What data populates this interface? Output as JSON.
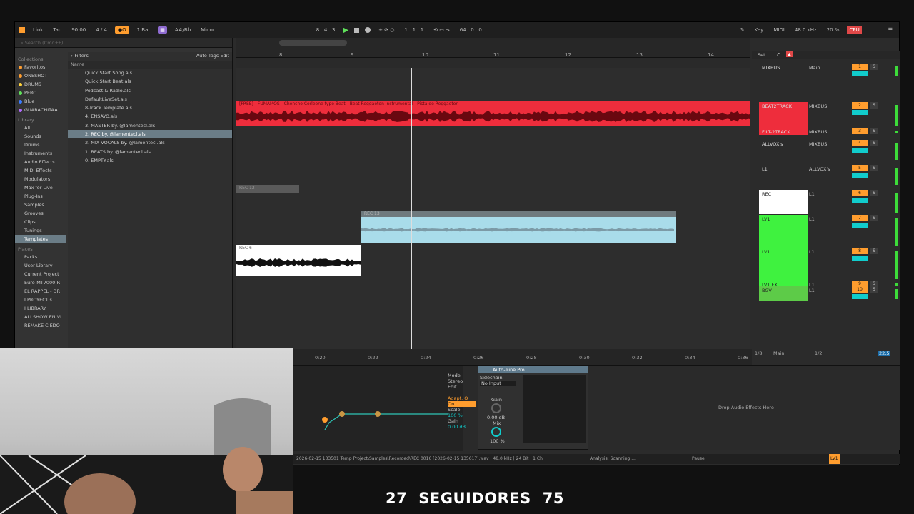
{
  "topbar": {
    "link": "Link",
    "tap": "Tap",
    "tempo": "90.00",
    "sig": "4 / 4",
    "quant": "1 Bar",
    "key": "A#/Bb",
    "scale": "Minor",
    "position": "8 . 4 . 3",
    "loop_start": "1 . 1 . 1",
    "loop_len": "64 . 0 . 0",
    "key_btn": "Key",
    "midi": "MIDI",
    "sample_rate": "48.0 kHz",
    "cpu_pct": "20 %",
    "cpu": "CPU"
  },
  "browser": {
    "search_placeholder": "Search (Cmd+F)",
    "collections_header": "Collections",
    "collections": [
      {
        "label": "Favoritos",
        "color": "#ff9d2e"
      },
      {
        "label": "ONESHOT",
        "color": "#ff9d2e"
      },
      {
        "label": "DRUMS",
        "color": "#ffd23a"
      },
      {
        "label": "PERC",
        "color": "#5fe05a"
      },
      {
        "label": "Blue",
        "color": "#3a7bff"
      },
      {
        "label": "GUARACHITAA",
        "color": "#b36bff"
      }
    ],
    "library_header": "Library",
    "library": [
      "All",
      "Sounds",
      "Drums",
      "Instruments",
      "Audio Effects",
      "MIDI Effects",
      "Modulators",
      "Max for Live",
      "Plug-Ins",
      "Samples",
      "Grooves",
      "Clips",
      "Tunings",
      "Templates"
    ],
    "places_header": "Places",
    "places": [
      "Packs",
      "User Library",
      "Current Project",
      "Euro-MT7000-R",
      "EL RAPPEL - DR",
      "I PROYECT's",
      "I LIBRARY",
      "ALI SHOW EN VI",
      "REMAKE CIEDO"
    ],
    "filters": "Filters",
    "auto_tags": "Auto Tags",
    "edit": "Edit",
    "name_col": "Name",
    "files": [
      "Quick Start Song.als",
      "Quick Start Beat.als",
      "Podcast & Radio.als",
      "DefaultLiveSet.als",
      "8-Track Template.als",
      "4. ENSAYO.als",
      "3. MASTER by. @lamentecl.als",
      "2. REC by. @lamentecl.als",
      "2. MIX VOCALS by. @lamentecl.als",
      "1. BEATS by. @lamentecl.als",
      "0. EMPTY.als"
    ]
  },
  "ruler": {
    "bars": [
      "8",
      "9",
      "10",
      "11",
      "12",
      "13",
      "14"
    ]
  },
  "clips": {
    "beat_label": "[FREE] - FUMAMOS - Chencho Corleone type Beat - Beat Reggaeton Instrumental - Pista de Reggaeton",
    "rec12": "REC 12",
    "rec13": "REC 13",
    "rec6": "REC 6"
  },
  "mixer": {
    "set": "Set",
    "tracks": [
      {
        "name": "MIXBUS",
        "route": "Main",
        "num": "1",
        "color": "#2b2b2b"
      },
      {
        "name": "BEAT2TRACK",
        "route": "MIXBUS",
        "num": "2",
        "color": "#ee2d3c"
      },
      {
        "name": "FILT-2TRACK",
        "route": "MIXBUS",
        "num": "3",
        "color": "#ee2d3c"
      },
      {
        "name": "ALLVOX's",
        "route": "MIXBUS",
        "num": "4",
        "color": "#2b2b2b"
      },
      {
        "name": "L1",
        "route": "ALLVOX's",
        "num": "5",
        "color": "#2b2b2b"
      },
      {
        "name": "REC",
        "route": "L1",
        "num": "6",
        "color": "#ffffff"
      },
      {
        "name": "LV1",
        "route": "L1",
        "num": "7",
        "color": "#3ff23f"
      },
      {
        "name": "LV1",
        "route": "L1",
        "num": "8",
        "color": "#3ff23f"
      },
      {
        "name": "LV1 FX",
        "route": "L1",
        "num": "9",
        "color": "#3ff23f"
      },
      {
        "name": "BGV",
        "route": "L1",
        "num": "10",
        "color": "#5dcb48"
      }
    ],
    "main": "Main",
    "main_route": "1/2",
    "main_frac": "1/8",
    "main_db": "22.5"
  },
  "timeline2": {
    "times": [
      "0:20",
      "0:22",
      "0:24",
      "0:26",
      "0:28",
      "0:30",
      "0:32",
      "0:34",
      "0:36"
    ]
  },
  "device": {
    "eq_mode": "Mode",
    "eq_mode_val": "Stereo",
    "eq_edit": "Edit",
    "eq_adapt": "Adapt. Q",
    "eq_on": "On",
    "eq_scale": "Scale",
    "eq_scale_val": "100 %",
    "eq_gain": "Gain",
    "eq_gain_val": "0.00 dB",
    "autotune": "Auto-Tune Pro",
    "sidechain": "Sidechain",
    "no_input": "No Input",
    "gain": "Gain",
    "gain_val": "0.00 dB",
    "mix": "Mix",
    "mix_val": "100 %",
    "drop": "Drop Audio Effects Here"
  },
  "status": {
    "file": "2026-02-15 133501 Temp Project\\Samples\\Recorded\\REC 0016 [2026-02-15 135617].wav | 48.0 kHz | 24 Bit | 1 Ch",
    "analysis": "Analysis: Scanning ...",
    "pause": "Pause",
    "track": "LV1"
  },
  "overlay": {
    "left_num": "27",
    "label": "SEGUIDORES",
    "right_num": "75"
  }
}
